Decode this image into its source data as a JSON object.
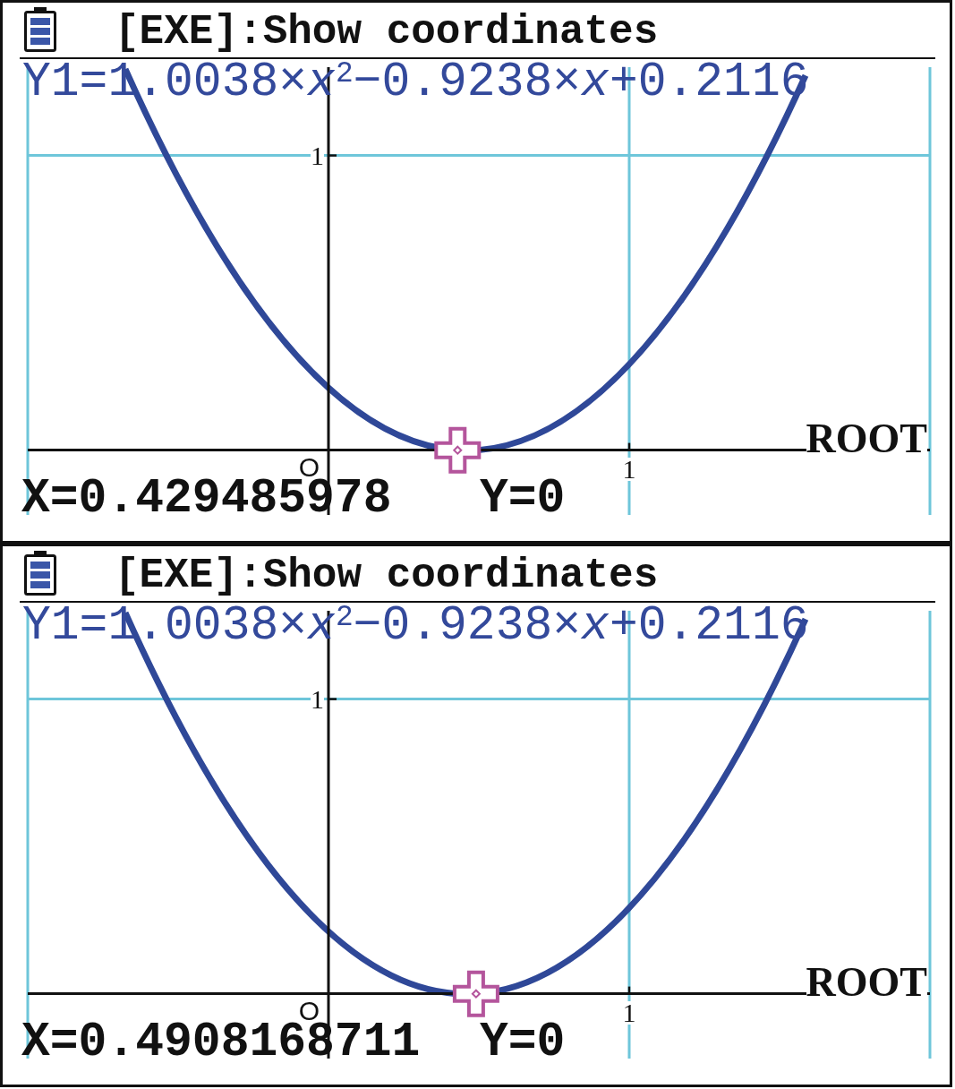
{
  "screens": [
    {
      "instruction": "[EXE]:Show coordinates",
      "function": "Y1=1.0038×*x*$^{2}$−0.9238×*x*+0.2116",
      "graph": {
        "y_tick_label": "1",
        "x_tick_label": "1",
        "origin_label": "O",
        "mode_label": "ROOT",
        "cursor": {
          "level": 0.4765
        }
      },
      "readout": {
        "x": "X=0.429485978",
        "y": "Y=0"
      }
    },
    {
      "instruction": "[EXE]:Show coordinates",
      "function": "Y1=1.0038×*x*$^{2}$−0.9238×*x*+0.2116",
      "graph": {
        "y_tick_label": "1",
        "x_tick_label": "1",
        "origin_label": "O",
        "mode_label": "ROOT",
        "cursor": {
          "level": 0.4969
        }
      },
      "readout": {
        "x": "X=0.4908168711",
        "y": "Y=0"
      }
    }
  ]
}
